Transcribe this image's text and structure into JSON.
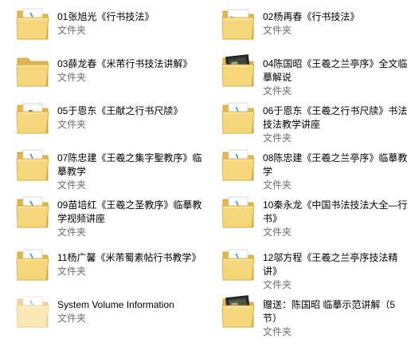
{
  "items": [
    {
      "name": "01张旭光《行书技法》",
      "type": "文件夹",
      "icon": "folder-icon",
      "preview": "paper"
    },
    {
      "name": "02杨再春《行书技法》",
      "type": "文件夹",
      "icon": "folder-video-icon",
      "preview": "media"
    },
    {
      "name": "03薛龙春《米芾行书技法讲解》",
      "type": "文件夹",
      "icon": "folder-icon",
      "preview": "plain"
    },
    {
      "name": "04陈国昭《王羲之兰亭序》全文临摹解说",
      "type": "文件夹",
      "icon": "folder-image-icon",
      "preview": "photo"
    },
    {
      "name": "05于恩东《王献之行书尺牍》",
      "type": "文件夹",
      "icon": "folder-icon",
      "preview": "doc"
    },
    {
      "name": "06于恩东《王羲之行书尺牍》书法技法教学讲座",
      "type": "文件夹",
      "icon": "folder-icon",
      "preview": "paper"
    },
    {
      "name": "07陈忠建《王羲之集字聖教序》临摹教学",
      "type": "文件夹",
      "icon": "folder-icon",
      "preview": "paper"
    },
    {
      "name": "08陈忠建《王羲之兰亭序》临摹教学",
      "type": "文件夹",
      "icon": "folder-icon",
      "preview": "paper"
    },
    {
      "name": "09苗培红《王羲之圣教序》临摹教学视频讲座",
      "type": "文件夹",
      "icon": "folder-icon",
      "preview": "paper"
    },
    {
      "name": "10秦永龙《中国书法技法大全—行书》",
      "type": "文件夹",
      "icon": "folder-icon",
      "preview": "paper"
    },
    {
      "name": "11杨广馨《米芾蜀素帖行书教学》",
      "type": "文件夹",
      "icon": "folder-icon",
      "preview": "paper"
    },
    {
      "name": "12邬方程《王羲之兰亭序技法精讲》",
      "type": "文件夹",
      "icon": "folder-icon",
      "preview": "paper"
    },
    {
      "name": "System Volume Information",
      "type": "文件夹",
      "icon": "folder-icon",
      "preview": "faded"
    },
    {
      "name": "赠送：陈国昭 临摹示范讲解（5节）",
      "type": "文件夹",
      "icon": "folder-image-icon",
      "preview": "photo2"
    }
  ]
}
